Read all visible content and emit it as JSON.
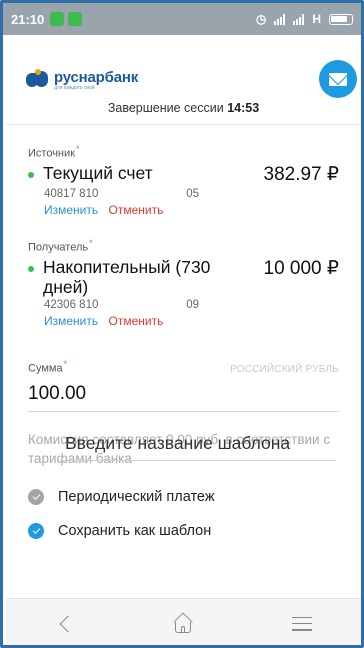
{
  "status_bar": {
    "time": "21:10",
    "network": "H"
  },
  "header": {
    "brand": "руснарбанк",
    "tagline": "для каждого свой",
    "session_label": "Завершение сессии",
    "session_time": "14:53"
  },
  "source": {
    "label": "Источник",
    "account_name": "Текущий счет",
    "amount": "382.97 ₽",
    "account_num_start": "40817 810",
    "account_num_end": "05",
    "change_label": "Изменить",
    "cancel_label": "Отменить"
  },
  "destination": {
    "label": "Получатель",
    "account_name": "Накопительный (730 дней)",
    "amount": "10 000 ₽",
    "account_num_start": "42306 810",
    "account_num_end": "09",
    "change_label": "Изменить",
    "cancel_label": "Отменить"
  },
  "sum": {
    "label": "Сумма",
    "currency": "РОССИЙСКИЙ РУБЛЬ",
    "value": "100.00"
  },
  "commission_text": "Комиссия составляет 0.00 руб. в соответствии с тарифами банка",
  "options": {
    "periodic_label": "Периодический платеж",
    "periodic_checked": true,
    "save_template_label": "Сохранить как шаблон",
    "save_template_checked": true
  },
  "template_name": {
    "placeholder": "Введите название шаблона",
    "value": ""
  },
  "colors": {
    "brand_blue": "#1b5a9c",
    "accent_blue": "#1e9be0",
    "green": "#3dbb4e",
    "red": "#e0362e"
  },
  "nav": {
    "icons": [
      "back-icon",
      "home-icon",
      "menu-icon"
    ]
  }
}
